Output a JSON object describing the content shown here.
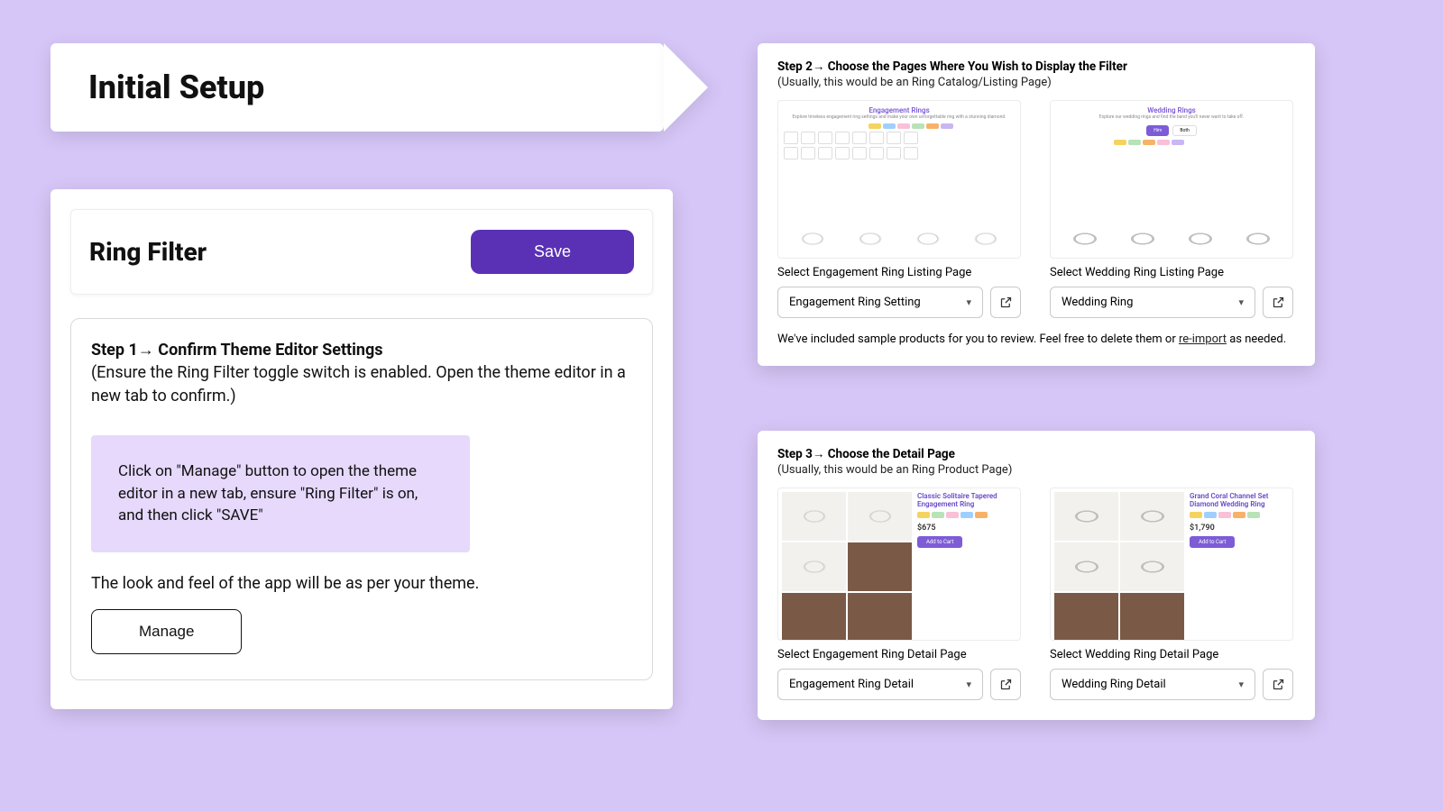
{
  "banner": {
    "title": "Initial Setup"
  },
  "header": {
    "title": "Ring Filter",
    "save_label": "Save"
  },
  "step1": {
    "title": "Step 1→  Confirm Theme Editor Settings",
    "subtitle": "(Ensure the Ring Filter toggle switch is enabled. Open the theme editor in a new tab to confirm.)",
    "callout": "Click on \"Manage\" button to open the theme editor in a new tab, ensure \"Ring Filter\" is on, and then click \"SAVE\"",
    "look_feel": "The look and feel of the app will be as per your theme.",
    "manage_label": "Manage"
  },
  "step2": {
    "title": "Step 2→ Choose the Pages Where You Wish to Display the Filter",
    "subtitle": "(Usually, this would be an Ring Catalog/Listing Page)",
    "left": {
      "preview_title": "Engagement Rings",
      "label": "Select Engagement Ring Listing Page",
      "value": "Engagement Ring Setting"
    },
    "right": {
      "preview_title": "Wedding Rings",
      "label": "Select Wedding Ring Listing Page",
      "value": "Wedding Ring"
    },
    "note_prefix": "We've included sample products for you to review. Feel free to delete them or ",
    "note_link": "re-import",
    "note_suffix": " as needed."
  },
  "step3": {
    "title": "Step 3→ Choose the Detail Page",
    "subtitle": "(Usually, this would be an Ring Product Page)",
    "left": {
      "preview_title": "Classic Solitaire Tapered Engagement Ring",
      "price": "$675",
      "label": "Select Engagement Ring Detail Page",
      "value": "Engagement Ring Detail"
    },
    "right": {
      "preview_title": "Grand Coral Channel Set Diamond Wedding Ring",
      "price": "$1,790",
      "label": "Select Wedding Ring Detail Page",
      "value": "Wedding Ring Detail"
    }
  }
}
